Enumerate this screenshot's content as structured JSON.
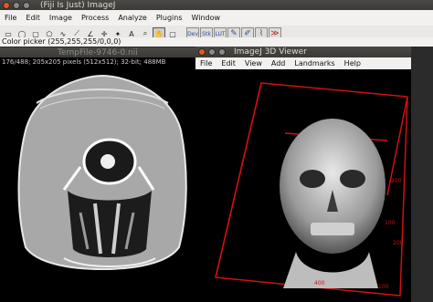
{
  "main": {
    "title": "(Fiji Is Just) ImageJ",
    "menu": [
      "File",
      "Edit",
      "Image",
      "Process",
      "Analyze",
      "Plugins",
      "Window"
    ],
    "tools": [
      {
        "icon": "rectangle-icon",
        "glyph": "▭"
      },
      {
        "icon": "oval-icon",
        "glyph": "◯"
      },
      {
        "icon": "rounded-rect-icon",
        "glyph": "▢"
      },
      {
        "icon": "polygon-icon",
        "glyph": "⬠"
      },
      {
        "icon": "freehand-icon",
        "glyph": "∿"
      },
      {
        "icon": "line-icon",
        "glyph": "⟋"
      },
      {
        "icon": "angle-icon",
        "glyph": "∠"
      },
      {
        "icon": "point-icon",
        "glyph": "✛"
      },
      {
        "icon": "wand-icon",
        "glyph": "✦"
      },
      {
        "icon": "text-icon",
        "glyph": "A"
      },
      {
        "icon": "magnifier-icon",
        "glyph": "⌕"
      },
      {
        "icon": "hand-icon",
        "glyph": "✋"
      },
      {
        "icon": "color-picker-icon",
        "glyph": "▢"
      }
    ],
    "plugin_tools": [
      {
        "icon": "dev-icon",
        "text": "Dev"
      },
      {
        "icon": "stk-icon",
        "text": "Stk"
      },
      {
        "icon": "lut-icon",
        "text": "LUT"
      },
      {
        "icon": "pencil-icon",
        "text": "✎"
      },
      {
        "icon": "brush-icon",
        "text": "✐"
      },
      {
        "icon": "dropper-icon",
        "text": "⌇"
      },
      {
        "icon": "arrow-more-icon",
        "text": "≫"
      }
    ],
    "status": "Color picker (255,255,255/0,0,0)"
  },
  "image_window": {
    "title": "TempFile-9746-0.nii",
    "info": "176/488; 205x205 pixels (512x512); 32-bit; 488MB"
  },
  "viewer3d": {
    "title": "ImageJ 3D Viewer",
    "menu": [
      "File",
      "Edit",
      "View",
      "Add",
      "Landmarks",
      "Help"
    ],
    "axis_labels": [
      "200",
      "100",
      "200",
      "100",
      "400"
    ],
    "accent": "#d01010"
  }
}
